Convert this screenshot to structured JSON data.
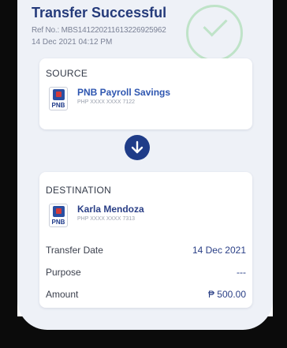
{
  "header": {
    "title": "Transfer Successful",
    "ref": "Ref No.: MBS141220211613226925962",
    "datetime": "14 Dec 2021 04:12 PM"
  },
  "source": {
    "label": "SOURCE",
    "bank": "PNB",
    "account_name": "PNB Payroll Savings",
    "account_number": "PHP XXXX XXXX 7122"
  },
  "destination": {
    "label": "DESTINATION",
    "bank": "PNB",
    "account_name": "Karla Mendoza",
    "account_number": "PHP XXXX XXXX 7313",
    "details": [
      {
        "label": "Transfer Date",
        "value": "14 Dec 2021"
      },
      {
        "label": "Purpose",
        "value": "---"
      },
      {
        "label": "Amount",
        "value": "₱ 500.00"
      }
    ]
  },
  "icons": {
    "success": "check-circle-icon",
    "direction": "arrow-down-icon"
  },
  "colors": {
    "primary": "#1f3c88",
    "success_ring": "#bfe3c8",
    "background": "#eef1f7"
  }
}
